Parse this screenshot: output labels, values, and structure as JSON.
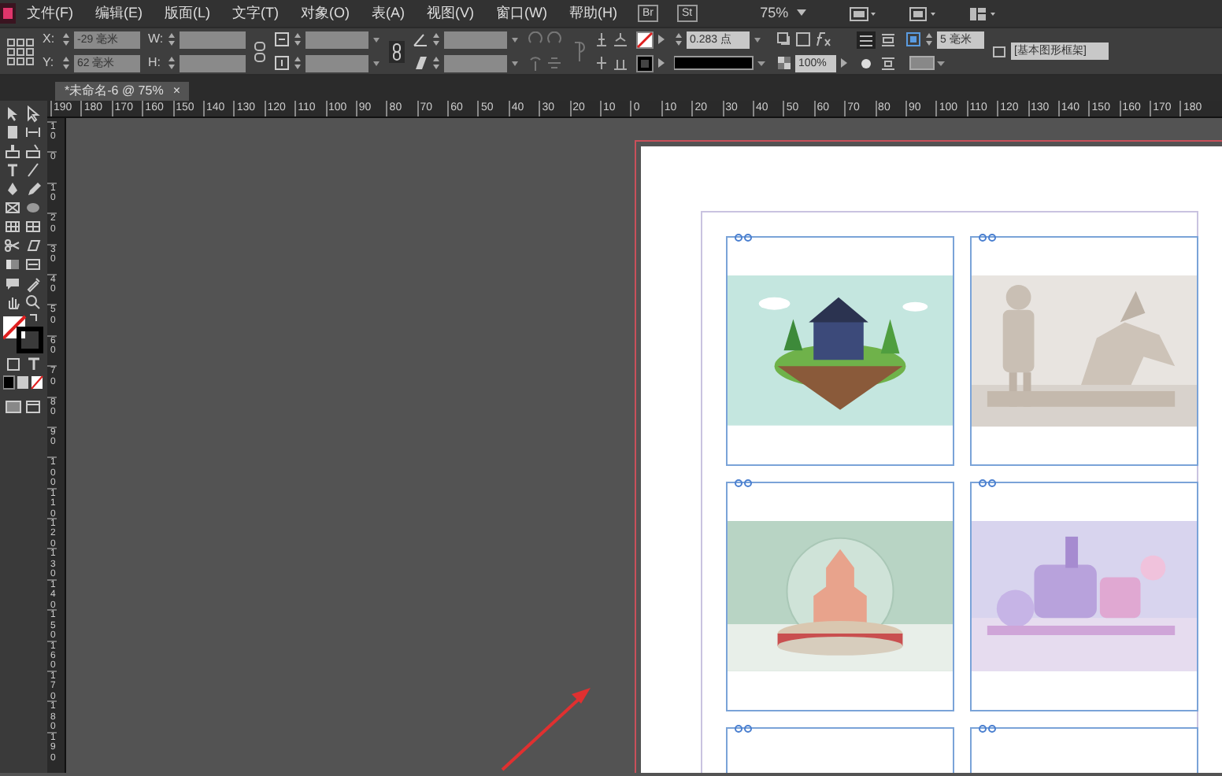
{
  "menu_bar": {
    "items": [
      "文件(F)",
      "编辑(E)",
      "版面(L)",
      "文字(T)",
      "对象(O)",
      "表(A)",
      "视图(V)",
      "窗口(W)",
      "帮助(H)"
    ],
    "bridge_buttons": [
      "Br",
      "St"
    ],
    "zoom": "75%"
  },
  "control_panel": {
    "position_fields": [
      {
        "label": "X:",
        "value": "-29 毫米"
      },
      {
        "label": "Y:",
        "value": "62 毫米"
      }
    ],
    "size_fields": [
      {
        "label": "W:"
      },
      {
        "label": "H:"
      }
    ],
    "stroke_weight": "0.283 点",
    "opacity": "100%",
    "wrap_offset": "5 毫米",
    "object_style": "[基本图形框架]"
  },
  "document_tab": {
    "title": "*未命名-6 @ 75%",
    "close": "×",
    "selected": true
  },
  "rulers": {
    "horizontal": [
      "190",
      "180",
      "170",
      "160",
      "150",
      "140",
      "130",
      "120",
      "110",
      "100",
      "90",
      "80",
      "70",
      "60",
      "50",
      "40",
      "30",
      "20",
      "10",
      "0",
      "10",
      "20",
      "30",
      "40",
      "50",
      "60",
      "70",
      "80",
      "90",
      "100",
      "110",
      "120",
      "130",
      "140",
      "150",
      "160",
      "170",
      "180"
    ],
    "vertical": [
      "10",
      "0",
      "10",
      "20",
      "30",
      "40",
      "50",
      "60",
      "70",
      "80",
      "90",
      "100",
      "110",
      "120",
      "130",
      "140",
      "150",
      "160",
      "170",
      "180",
      "190"
    ]
  },
  "page": {
    "frames": [
      {
        "kind": "picture"
      },
      {
        "kind": "picture"
      },
      {
        "kind": "picture"
      },
      {
        "kind": "picture"
      },
      {
        "kind": "empty"
      },
      {
        "kind": "empty"
      }
    ]
  }
}
